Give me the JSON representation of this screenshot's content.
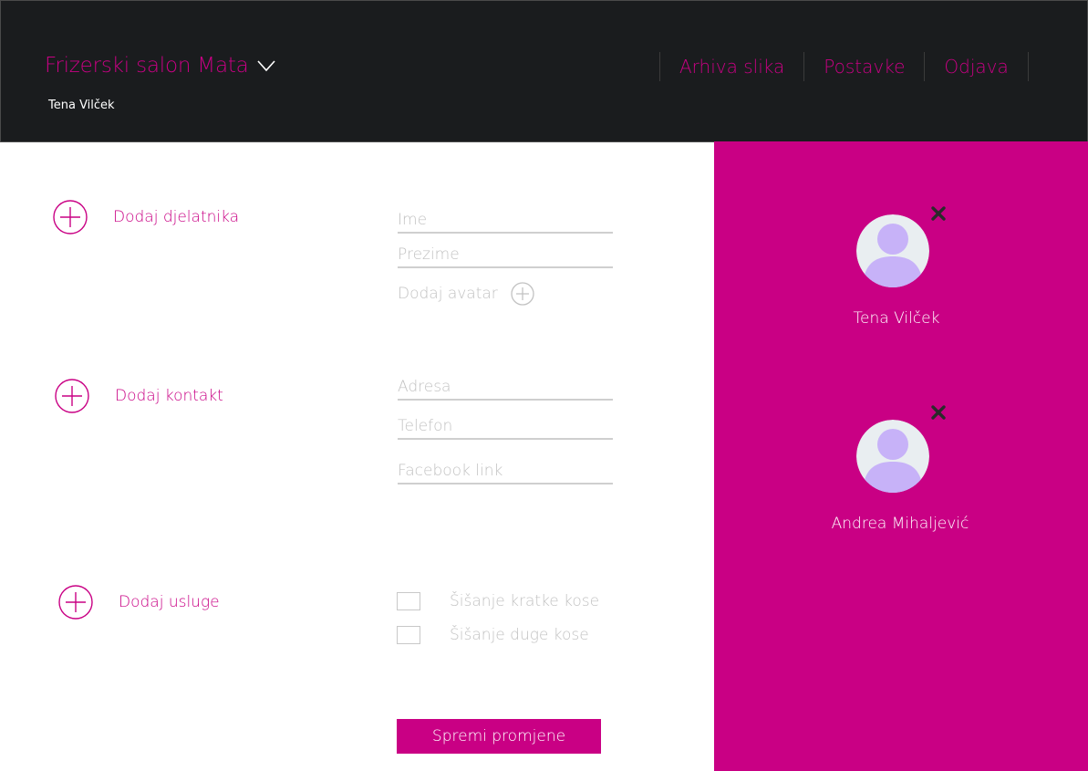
{
  "header": {
    "brand": "Frizerski salon Mata",
    "user": "Tena Vilček",
    "nav": [
      {
        "label": "Arhiva slika"
      },
      {
        "label": "Postavke"
      },
      {
        "label": "Odjava"
      }
    ]
  },
  "sections": {
    "employee": {
      "add_label": "Dodaj djelatnika",
      "first_name_placeholder": "Ime",
      "first_name_value": "",
      "last_name_placeholder": "Prezime",
      "last_name_value": "",
      "avatar_label": "Dodaj avatar"
    },
    "contact": {
      "add_label": "Dodaj kontakt",
      "address_placeholder": "Adresa",
      "address_value": "",
      "phone_placeholder": "Telefon",
      "phone_value": "",
      "facebook_placeholder": "Facebook link",
      "facebook_value": ""
    },
    "services": {
      "add_label": "Dodaj usluge",
      "items": [
        {
          "label": "Šišanje kratke kose",
          "checked": false
        },
        {
          "label": "Šišanje duge kose",
          "checked": false
        }
      ]
    }
  },
  "save_label": "Spremi promjene",
  "employees": [
    {
      "name": "Tena Vilček"
    },
    {
      "name": "Andrea Mihaljević"
    }
  ],
  "colors": {
    "accent": "#c90084",
    "header_bg": "#1a1c1e",
    "avatar_bg": "#e9eef1",
    "avatar_figure": "#c7b2f8",
    "remove_icon": "#2b2b2b"
  },
  "icons": {
    "brand_dropdown": "chevron-down-icon",
    "add_section": "plus-circle-icon",
    "add_avatar": "plus-circle-icon",
    "remove_employee": "close-icon",
    "employee_avatar": "user-avatar-icon"
  }
}
